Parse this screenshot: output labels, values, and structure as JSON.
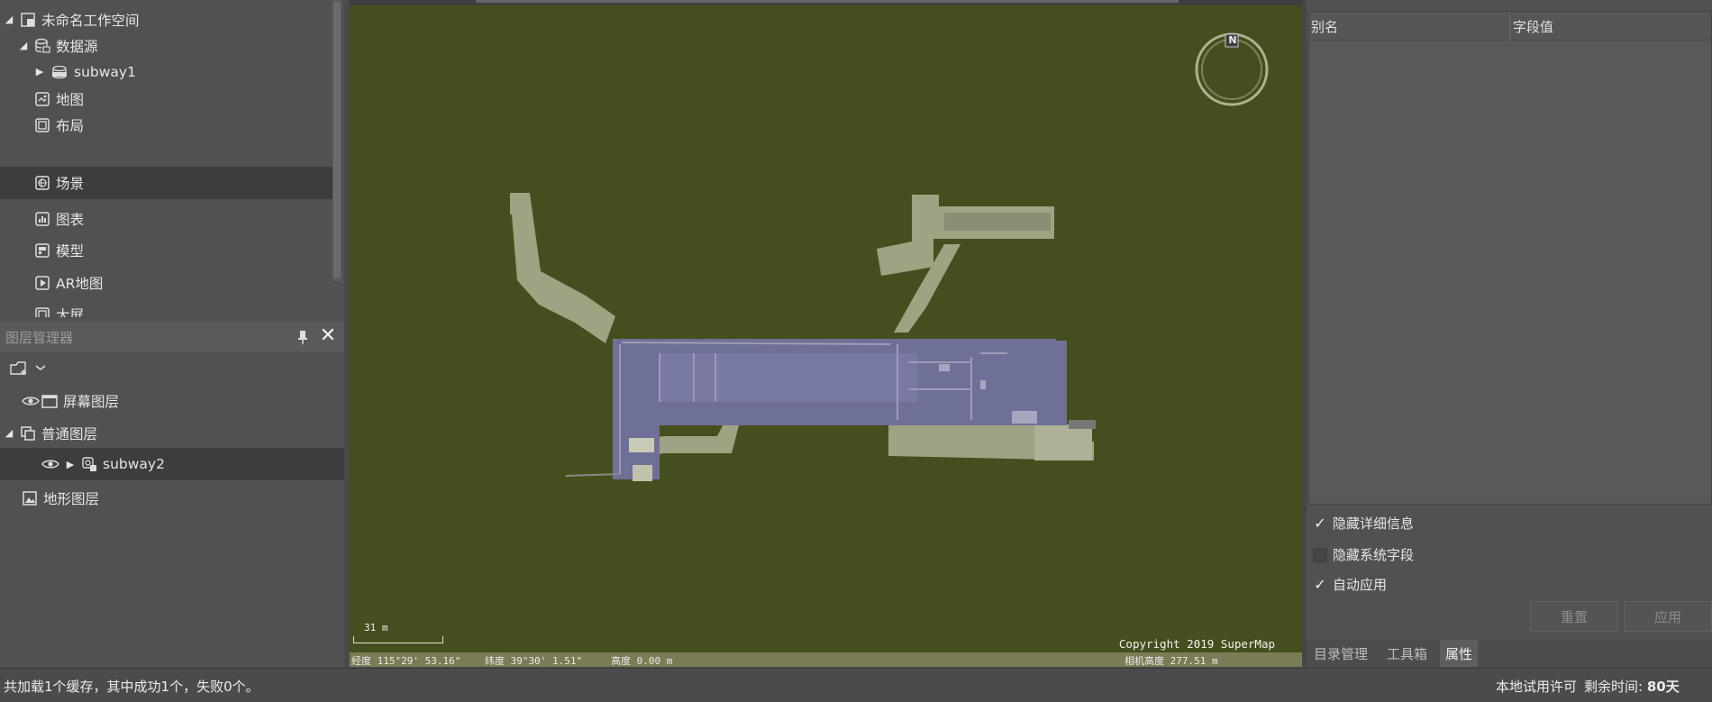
{
  "workspace_tree": {
    "items": [
      {
        "label": "未命名工作空间",
        "icon": "workspace-icon",
        "expanded": true
      },
      {
        "label": "数据源",
        "icon": "datasource-icon",
        "expanded": true
      },
      {
        "label": "subway1",
        "icon": "database-icon",
        "expanded": false
      },
      {
        "label": "地图",
        "icon": "map-icon"
      },
      {
        "label": "布局",
        "icon": "layout-icon"
      },
      {
        "label": "场景",
        "icon": "scene-icon",
        "selected": true
      },
      {
        "label": "图表",
        "icon": "chart-icon"
      },
      {
        "label": "模型",
        "icon": "model-icon"
      },
      {
        "label": "AR地图",
        "icon": "ar-map-icon"
      },
      {
        "label": "大屏",
        "icon": "screen-icon"
      }
    ]
  },
  "layer_manager": {
    "title": "图层管理器",
    "layers": [
      {
        "label": "屏幕图层",
        "icon": "screen-layer-icon",
        "visible": true
      },
      {
        "label": "普通图层",
        "icon": "normal-layer-icon",
        "expanded": true
      },
      {
        "label": "subway2",
        "icon": "cache-layer-icon",
        "visible": true,
        "selected": true
      },
      {
        "label": "地形图层",
        "icon": "terrain-layer-icon"
      }
    ]
  },
  "scene": {
    "copyright": "Copyright 2019 SuperMap",
    "scale": "31 m",
    "longitude": "经度 115°29' 53.16\"",
    "latitude": "纬度 39°30' 1.51\"",
    "altitude": "高度 0.00 m",
    "camera_height": "相机高度 277.51 m",
    "compass_label": "N",
    "background_color": "#454f1e"
  },
  "attributes": {
    "col_alias": "别名",
    "col_value": "字段值",
    "hide_details": {
      "label": "隐藏详细信息",
      "checked": true
    },
    "hide_system_fields": {
      "label": "隐藏系统字段",
      "checked": false
    },
    "auto_apply": {
      "label": "自动应用",
      "checked": true
    },
    "reset_label": "重置",
    "apply_label": "应用"
  },
  "right_tabs": [
    {
      "label": "目录管理"
    },
    {
      "label": "工具箱"
    },
    {
      "label": "属性",
      "active": true
    }
  ],
  "statusbar": {
    "message": "共加载1个缓存，其中成功1个，失败0个。",
    "license": "本地试用许可",
    "remaining_label": "剩余时间:",
    "remaining_value": "80天"
  }
}
